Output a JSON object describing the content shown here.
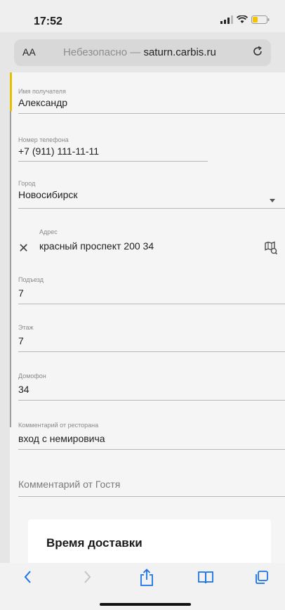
{
  "status": {
    "time": "17:52"
  },
  "browser": {
    "aa_label": "AA",
    "insecure_label": "Небезопасно —",
    "domain": "saturn.carbis.ru"
  },
  "form": {
    "recipient": {
      "label": "Имя получателя",
      "value": "Александр"
    },
    "phone": {
      "label": "Номер телефона",
      "value": "+7 (911) 111-11-11"
    },
    "city": {
      "label": "Город",
      "value": "Новосибирск"
    },
    "address": {
      "label": "Адрес",
      "value": "красный проспект 200 34"
    },
    "entrance": {
      "label": "Подъезд",
      "value": "7"
    },
    "floor": {
      "label": "Этаж",
      "value": "7"
    },
    "intercom": {
      "label": "Домофон",
      "value": "34"
    },
    "restaurant_comment": {
      "label": "Комментарий от ресторана",
      "value": "вход с немировича"
    },
    "guest_comment": {
      "placeholder": "Комментарий от Гостя"
    }
  },
  "delivery_card": {
    "title": "Время доставки"
  },
  "colors": {
    "accent": "#e6c000",
    "toolbar_icons": "#1a73e8"
  },
  "icons": [
    "signal-icon",
    "wifi-icon",
    "battery-icon",
    "reload-icon",
    "clear-icon",
    "map-pin-icon",
    "back-icon",
    "forward-icon",
    "share-icon",
    "bookmarks-icon",
    "tabs-icon"
  ]
}
